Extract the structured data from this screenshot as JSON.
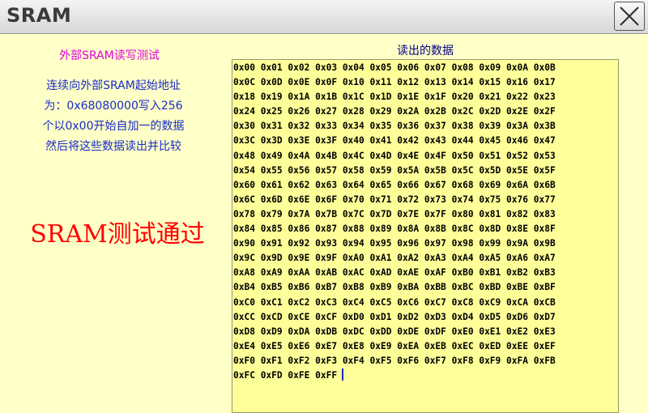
{
  "window": {
    "title": "SRAM"
  },
  "left": {
    "subtitle": "外部SRAM读写测试",
    "description": [
      "连续向外部SRAM起始地址",
      "为：0x68080000写入256",
      "个以0x00开始自加一的数据",
      "然后将这些数据读出并比较"
    ],
    "result": "SRAM测试通过"
  },
  "data_panel": {
    "header": "读出的数据",
    "values": [
      "0x00",
      "0x01",
      "0x02",
      "0x03",
      "0x04",
      "0x05",
      "0x06",
      "0x07",
      "0x08",
      "0x09",
      "0x0A",
      "0x0B",
      "0x0C",
      "0x0D",
      "0x0E",
      "0x0F",
      "0x10",
      "0x11",
      "0x12",
      "0x13",
      "0x14",
      "0x15",
      "0x16",
      "0x17",
      "0x18",
      "0x19",
      "0x1A",
      "0x1B",
      "0x1C",
      "0x1D",
      "0x1E",
      "0x1F",
      "0x20",
      "0x21",
      "0x22",
      "0x23",
      "0x24",
      "0x25",
      "0x26",
      "0x27",
      "0x28",
      "0x29",
      "0x2A",
      "0x2B",
      "0x2C",
      "0x2D",
      "0x2E",
      "0x2F",
      "0x30",
      "0x31",
      "0x32",
      "0x33",
      "0x34",
      "0x35",
      "0x36",
      "0x37",
      "0x38",
      "0x39",
      "0x3A",
      "0x3B",
      "0x3C",
      "0x3D",
      "0x3E",
      "0x3F",
      "0x40",
      "0x41",
      "0x42",
      "0x43",
      "0x44",
      "0x45",
      "0x46",
      "0x47",
      "0x48",
      "0x49",
      "0x4A",
      "0x4B",
      "0x4C",
      "0x4D",
      "0x4E",
      "0x4F",
      "0x50",
      "0x51",
      "0x52",
      "0x53",
      "0x54",
      "0x55",
      "0x56",
      "0x57",
      "0x58",
      "0x59",
      "0x5A",
      "0x5B",
      "0x5C",
      "0x5D",
      "0x5E",
      "0x5F",
      "0x60",
      "0x61",
      "0x62",
      "0x63",
      "0x64",
      "0x65",
      "0x66",
      "0x67",
      "0x68",
      "0x69",
      "0x6A",
      "0x6B",
      "0x6C",
      "0x6D",
      "0x6E",
      "0x6F",
      "0x70",
      "0x71",
      "0x72",
      "0x73",
      "0x74",
      "0x75",
      "0x76",
      "0x77",
      "0x78",
      "0x79",
      "0x7A",
      "0x7B",
      "0x7C",
      "0x7D",
      "0x7E",
      "0x7F",
      "0x80",
      "0x81",
      "0x82",
      "0x83",
      "0x84",
      "0x85",
      "0x86",
      "0x87",
      "0x88",
      "0x89",
      "0x8A",
      "0x8B",
      "0x8C",
      "0x8D",
      "0x8E",
      "0x8F",
      "0x90",
      "0x91",
      "0x92",
      "0x93",
      "0x94",
      "0x95",
      "0x96",
      "0x97",
      "0x98",
      "0x99",
      "0x9A",
      "0x9B",
      "0x9C",
      "0x9D",
      "0x9E",
      "0x9F",
      "0xA0",
      "0xA1",
      "0xA2",
      "0xA3",
      "0xA4",
      "0xA5",
      "0xA6",
      "0xA7",
      "0xA8",
      "0xA9",
      "0xAA",
      "0xAB",
      "0xAC",
      "0xAD",
      "0xAE",
      "0xAF",
      "0xB0",
      "0xB1",
      "0xB2",
      "0xB3",
      "0xB4",
      "0xB5",
      "0xB6",
      "0xB7",
      "0xB8",
      "0xB9",
      "0xBA",
      "0xBB",
      "0xBC",
      "0xBD",
      "0xBE",
      "0xBF",
      "0xC0",
      "0xC1",
      "0xC2",
      "0xC3",
      "0xC4",
      "0xC5",
      "0xC6",
      "0xC7",
      "0xC8",
      "0xC9",
      "0xCA",
      "0xCB",
      "0xCC",
      "0xCD",
      "0xCE",
      "0xCF",
      "0xD0",
      "0xD1",
      "0xD2",
      "0xD3",
      "0xD4",
      "0xD5",
      "0xD6",
      "0xD7",
      "0xD8",
      "0xD9",
      "0xDA",
      "0xDB",
      "0xDC",
      "0xDD",
      "0xDE",
      "0xDF",
      "0xE0",
      "0xE1",
      "0xE2",
      "0xE3",
      "0xE4",
      "0xE5",
      "0xE6",
      "0xE7",
      "0xE8",
      "0xE9",
      "0xEA",
      "0xEB",
      "0xEC",
      "0xED",
      "0xEE",
      "0xEF",
      "0xF0",
      "0xF1",
      "0xF2",
      "0xF3",
      "0xF4",
      "0xF5",
      "0xF6",
      "0xF7",
      "0xF8",
      "0xF9",
      "0xFA",
      "0xFB",
      "0xFC",
      "0xFD",
      "0xFE",
      "0xFF"
    ]
  },
  "colors": {
    "background": "#FFFFC8",
    "data_box": "#FFFF99",
    "subtitle": "#E000E0",
    "description": "#1A2CC8",
    "result": "#FF0000"
  },
  "icons": {
    "close": "close-icon"
  }
}
